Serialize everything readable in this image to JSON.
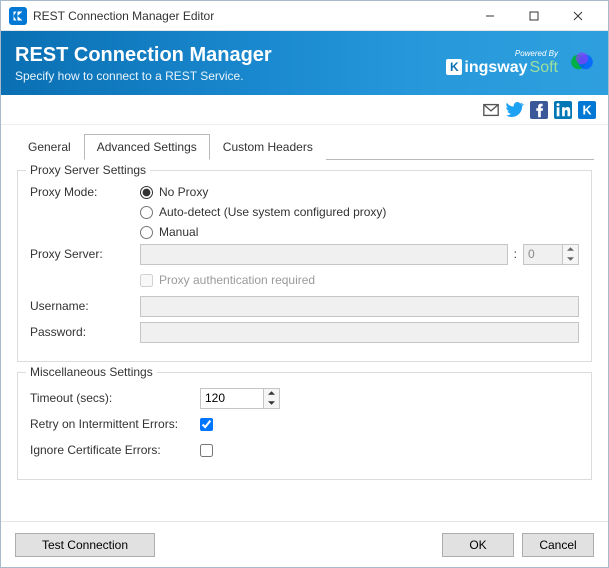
{
  "window": {
    "title": "REST Connection Manager Editor"
  },
  "header": {
    "title": "REST Connection Manager",
    "subtitle": "Specify how to connect to a REST Service.",
    "powered_by": "Powered By",
    "brand_prefix": "ingsway",
    "brand_suffix": "Soft"
  },
  "tabs": {
    "general": "General",
    "advanced": "Advanced Settings",
    "custom_headers": "Custom Headers",
    "active_index": 1
  },
  "proxy": {
    "legend": "Proxy Server Settings",
    "mode_label": "Proxy Mode:",
    "modes": {
      "none": "No Proxy",
      "auto": "Auto-detect (Use system configured proxy)",
      "manual": "Manual",
      "selected": "none"
    },
    "server_label": "Proxy Server:",
    "server_value": "",
    "port_value": "0",
    "auth_required_label": "Proxy authentication required",
    "auth_required": false,
    "username_label": "Username:",
    "username_value": "",
    "password_label": "Password:",
    "password_value": ""
  },
  "misc": {
    "legend": "Miscellaneous Settings",
    "timeout_label": "Timeout (secs):",
    "timeout_value": "120",
    "retry_label": "Retry on Intermittent Errors:",
    "retry_checked": true,
    "ignore_cert_label": "Ignore Certificate Errors:",
    "ignore_cert_checked": false
  },
  "footer": {
    "test": "Test Connection",
    "ok": "OK",
    "cancel": "Cancel"
  }
}
